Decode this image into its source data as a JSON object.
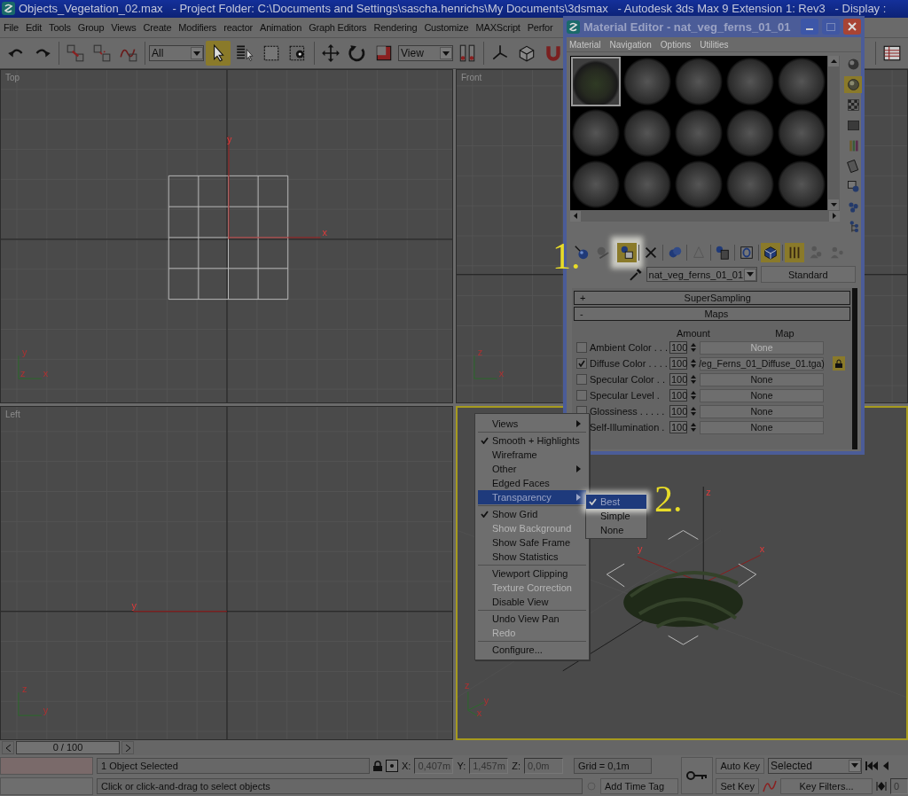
{
  "window": {
    "title": "Objects_Vegetation_02.max   - Project Folder: C:\\Documents and Settings\\sascha.henrichs\\My Documents\\3dsmax   - Autodesk 3ds Max 9 Extension 1: Rev3   - Display :"
  },
  "menu_bar": [
    "File",
    "Edit",
    "Tools",
    "Group",
    "Views",
    "Create",
    "Modifiers",
    "reactor",
    "Animation",
    "Graph Editors",
    "Rendering",
    "Customize",
    "MAXScript",
    "Perfor"
  ],
  "toolbar": [
    {
      "kind": "undo",
      "selected": false
    },
    {
      "kind": "redo",
      "selected": false
    },
    {
      "kind": "separator"
    },
    {
      "kind": "link",
      "selected": false
    },
    {
      "kind": "unlink",
      "selected": false
    },
    {
      "kind": "bind",
      "selected": false
    },
    {
      "kind": "separator"
    },
    {
      "kind": "dropdown",
      "value": "All"
    },
    {
      "kind": "select",
      "selected": true
    },
    {
      "kind": "select-list",
      "selected": false
    },
    {
      "kind": "rect-select",
      "selected": false
    },
    {
      "kind": "window-crossing",
      "selected": false
    },
    {
      "kind": "separator"
    },
    {
      "kind": "move",
      "selected": false
    },
    {
      "kind": "rotate",
      "selected": false
    },
    {
      "kind": "scale",
      "selected": false
    },
    {
      "kind": "dropdown",
      "value": "View"
    },
    {
      "kind": "pivot",
      "selected": false
    },
    {
      "kind": "separator"
    },
    {
      "kind": "axis",
      "selected": false
    },
    {
      "kind": "box",
      "selected": false
    },
    {
      "kind": "magnet"
    },
    {
      "kind": "spacer"
    },
    {
      "kind": "separator"
    },
    {
      "kind": "spreadsheet",
      "selected": false
    }
  ],
  "viewports": [
    {
      "label": "Top",
      "kind": "top",
      "active": false,
      "axis_labels": [
        "y",
        "x"
      ],
      "tripod": [
        "y",
        "z",
        "x"
      ]
    },
    {
      "label": "Front",
      "kind": "front",
      "active": false,
      "tripod": [
        "z",
        "x"
      ]
    },
    {
      "label": "Left",
      "kind": "left",
      "active": false,
      "axis_labels": [
        "y"
      ],
      "tripod": [
        "z",
        "y"
      ]
    },
    {
      "kind": "perspective",
      "active": true,
      "axis_labels": [
        "z",
        "y",
        "x"
      ],
      "tripod": [
        "z",
        "y",
        "x"
      ]
    }
  ],
  "timeline": {
    "position": "0 / 100",
    "level": 0
  },
  "status_bar": {
    "selection": "1 Object Selected",
    "prompt": "Click or click-and-drag to select objects",
    "x_label": "X:",
    "x": "0,407m",
    "y_label": "Y:",
    "y": "1,457m",
    "z_label": "Z:",
    "z": "0,0m",
    "grid": "Grid = 0,1m",
    "time_tag": "Add Time Tag",
    "auto_key": "Auto Key",
    "set_key": "Set Key",
    "key_mode": "Selected",
    "key_filters": "Key Filters...",
    "frame": "0"
  },
  "material_editor": {
    "title": "Material Editor - nat_veg_ferns_01_01",
    "menu": [
      "Material",
      "Navigation",
      "Options",
      "Utilities"
    ],
    "slots": [
      {
        "selected": true
      },
      {
        "selected": false
      },
      {
        "selected": false
      },
      {
        "selected": false
      },
      {
        "selected": false
      },
      {
        "selected": false
      },
      {
        "selected": false
      },
      {
        "selected": false
      },
      {
        "selected": false
      },
      {
        "selected": false
      },
      {
        "selected": false
      },
      {
        "selected": false
      },
      {
        "selected": false
      },
      {
        "selected": false
      },
      {
        "selected": false
      }
    ],
    "side_tools": [
      {
        "kind": "sphere",
        "selected": false
      },
      {
        "kind": "backlight",
        "selected": true
      },
      {
        "kind": "checker",
        "selected": false
      },
      {
        "kind": "square",
        "selected": false
      },
      {
        "kind": "color-bars",
        "selected": false
      },
      {
        "kind": "film",
        "selected": false
      },
      {
        "kind": "options",
        "selected": false
      },
      {
        "kind": "select-by",
        "selected": false
      },
      {
        "kind": "tree",
        "selected": false
      }
    ],
    "tools": [
      {
        "kind": "get",
        "selected": false
      },
      {
        "kind": "put-scene",
        "selected": false
      },
      {
        "kind": "separator"
      },
      {
        "kind": "assign",
        "selected": true,
        "spotlight": true
      },
      {
        "kind": "separator"
      },
      {
        "kind": "delete",
        "selected": false
      },
      {
        "kind": "separator"
      },
      {
        "kind": "copy",
        "selected": false
      },
      {
        "kind": "separator"
      },
      {
        "kind": "unique",
        "selected": false
      },
      {
        "kind": "separator"
      },
      {
        "kind": "put-library",
        "selected": false
      },
      {
        "kind": "separator"
      },
      {
        "kind": "effects",
        "selected": false
      },
      {
        "kind": "separator"
      },
      {
        "kind": "show-map",
        "selected": true
      },
      {
        "kind": "separator"
      },
      {
        "kind": "show-result",
        "selected": true
      },
      {
        "kind": "go-parent",
        "selected": false
      },
      {
        "kind": "go-sibling",
        "selected": false
      }
    ],
    "material_name": "nat_veg_ferns_01_01",
    "material_type": "Standard",
    "rollouts": [
      {
        "sign": "+",
        "title": "SuperSampling"
      },
      {
        "sign": "-",
        "title": "Maps"
      }
    ],
    "map_columns": [
      "Amount",
      "Map"
    ],
    "map_rows": [
      {
        "name": "Ambient Color . . .",
        "checked": false,
        "amount": "100",
        "map": "None",
        "disabled": true
      },
      {
        "name": "Diffuse Color . . . .",
        "checked": true,
        "amount": "100",
        "map": "/eg_Ferns_01_Diffuse_01.tga)",
        "disabled": false
      },
      {
        "name": "Specular Color . .",
        "checked": false,
        "amount": "100",
        "map": "None",
        "disabled": false
      },
      {
        "name": "Specular Level .",
        "checked": false,
        "amount": "100",
        "map": "None",
        "disabled": false
      },
      {
        "name": "Glossiness . . . . .",
        "checked": false,
        "amount": "100",
        "map": "None",
        "disabled": false
      },
      {
        "name": "Self-Illumination .",
        "amount": "100",
        "map": "None",
        "disabled": false
      }
    ]
  },
  "context_menu": {
    "groups": [
      {
        "items": [
          {
            "label": "Views",
            "checked": false,
            "disabled": false,
            "submenu": true,
            "selected": false
          }
        ]
      },
      {
        "items": [
          {
            "label": "Smooth + Highlights",
            "checked": true,
            "disabled": false,
            "submenu": false,
            "selected": false
          },
          {
            "label": "Wireframe",
            "checked": false,
            "disabled": false,
            "submenu": false,
            "selected": false
          },
          {
            "label": "Other",
            "checked": false,
            "disabled": false,
            "submenu": true,
            "selected": false
          },
          {
            "label": "Edged Faces",
            "checked": false,
            "disabled": false,
            "submenu": false,
            "selected": false
          },
          {
            "label": "Transparency",
            "checked": false,
            "disabled": false,
            "submenu": true,
            "selected": true
          }
        ]
      },
      {
        "items": [
          {
            "label": "Show Grid",
            "checked": true,
            "disabled": false,
            "submenu": false,
            "selected": false
          },
          {
            "label": "Show Background",
            "checked": false,
            "disabled": true,
            "submenu": false,
            "selected": false
          },
          {
            "label": "Show Safe Frame",
            "checked": false,
            "disabled": false,
            "submenu": false,
            "selected": false
          },
          {
            "label": "Show Statistics",
            "checked": false,
            "disabled": false,
            "submenu": false,
            "selected": false
          }
        ]
      },
      {
        "items": [
          {
            "label": "Viewport Clipping",
            "checked": false,
            "disabled": false,
            "submenu": false,
            "selected": false
          },
          {
            "label": "Texture Correction",
            "checked": false,
            "disabled": true,
            "submenu": false,
            "selected": false
          },
          {
            "label": "Disable View",
            "checked": false,
            "disabled": false,
            "submenu": false,
            "selected": false
          }
        ]
      },
      {
        "items": [
          {
            "label": "Undo View Pan",
            "checked": false,
            "disabled": false,
            "submenu": false,
            "selected": false
          },
          {
            "label": "Redo",
            "checked": false,
            "disabled": true,
            "submenu": false,
            "selected": false
          }
        ]
      },
      {
        "items": [
          {
            "label": "Configure...",
            "checked": false,
            "disabled": false,
            "submenu": false,
            "selected": false
          }
        ]
      }
    ]
  },
  "transparency_submenu": {
    "items": [
      {
        "label": "Best",
        "checked": true,
        "selected": true,
        "spotlight": true
      },
      {
        "label": "Simple",
        "checked": false,
        "selected": false
      },
      {
        "label": "None",
        "checked": false,
        "selected": false
      }
    ]
  },
  "annotations": [
    {
      "label": "1."
    },
    {
      "label": "2."
    }
  ]
}
